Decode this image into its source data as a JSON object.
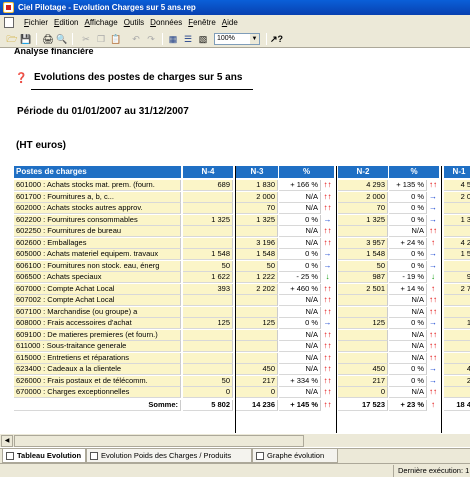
{
  "window": {
    "title": "Ciel Pilotage - Evolution Charges sur 5 ans.rep"
  },
  "menu": [
    "Fichier",
    "Edition",
    "Affichage",
    "Outils",
    "Données",
    "Fenêtre",
    "Aide"
  ],
  "toolbar": {
    "icons": [
      "open-icon",
      "save-icon",
      "print-icon",
      "print-preview-icon",
      "cut-icon",
      "copy-icon",
      "paste-icon",
      "undo-icon",
      "redo-icon",
      "grid-view-icon",
      "list-view-icon",
      "table-view-icon",
      "help-icon"
    ],
    "zoom": "100%"
  },
  "report": {
    "section_title": "Analyse financière",
    "title": "Evolutions des postes de charges sur 5 ans",
    "period": "Période du  01/01/2007   au   31/12/2007",
    "units": "(HT euros)"
  },
  "table": {
    "headers": {
      "label": "Postes de charges",
      "n4": "N-4",
      "n3": "N-3",
      "pct1": "%",
      "n2": "N-2",
      "pct2": "%",
      "n1": "N-1"
    },
    "rows": [
      {
        "label": "601000 : Achats stocks mat. prem. (fourn.",
        "n4": "689",
        "n3": "1 830",
        "pct1": "+ 166 %",
        "ar1": "up2",
        "n2": "4 293",
        "pct2": "+ 135 %",
        "ar2": "up2",
        "n1": "4 5"
      },
      {
        "label": "601700 : Fournitures a, b, c...",
        "n4": "",
        "n3": "2 000",
        "pct1": "N/A",
        "ar1": "up2",
        "n2": "2 000",
        "pct2": "0 %",
        "ar2": "right",
        "n1": "2 0"
      },
      {
        "label": "602000 : Achats stocks autres approv.",
        "n4": "",
        "n3": "70",
        "pct1": "N/A",
        "ar1": "up2",
        "n2": "70",
        "pct2": "0 %",
        "ar2": "right",
        "n1": ""
      },
      {
        "label": "602200 : Fournitures consommables",
        "n4": "1 325",
        "n3": "1 325",
        "pct1": "0 %",
        "ar1": "right",
        "n2": "1 325",
        "pct2": "0 %",
        "ar2": "right",
        "n1": "1 3"
      },
      {
        "label": "602250 : Fournitures de bureau",
        "n4": "",
        "n3": "",
        "pct1": "N/A",
        "ar1": "up2",
        "n2": "",
        "pct2": "N/A",
        "ar2": "up2",
        "n1": ""
      },
      {
        "label": "602600 : Emballages",
        "n4": "",
        "n3": "3 196",
        "pct1": "N/A",
        "ar1": "up2",
        "n2": "3 957",
        "pct2": "+ 24 %",
        "ar2": "up",
        "n1": "4 2"
      },
      {
        "label": "605000 : Achats materiel equipem. travaux",
        "n4": "1 548",
        "n3": "1 548",
        "pct1": "0 %",
        "ar1": "right",
        "n2": "1 548",
        "pct2": "0 %",
        "ar2": "right",
        "n1": "1 5"
      },
      {
        "label": "606100 : Fournitures non stock. eau, énerg",
        "n4": "50",
        "n3": "50",
        "pct1": "0 %",
        "ar1": "right",
        "n2": "50",
        "pct2": "0 %",
        "ar2": "right",
        "n1": ""
      },
      {
        "label": "606500 : Achats speciaux",
        "n4": "1 622",
        "n3": "1 222",
        "pct1": "- 25 %",
        "ar1": "down",
        "n2": "987",
        "pct2": "- 19 %",
        "ar2": "down",
        "n1": "9"
      },
      {
        "label": "607000 : Compte Achat Local",
        "n4": "393",
        "n3": "2 202",
        "pct1": "+ 460 %",
        "ar1": "up2",
        "n2": "2 501",
        "pct2": "+ 14 %",
        "ar2": "up",
        "n1": "2 7"
      },
      {
        "label": "607002 : Compte Achat Local",
        "n4": "",
        "n3": "",
        "pct1": "N/A",
        "ar1": "up2",
        "n2": "",
        "pct2": "N/A",
        "ar2": "up2",
        "n1": ""
      },
      {
        "label": "607100 : Marchandise (ou groupe) a",
        "n4": "",
        "n3": "",
        "pct1": "N/A",
        "ar1": "up2",
        "n2": "",
        "pct2": "N/A",
        "ar2": "up2",
        "n1": ""
      },
      {
        "label": "608000 : Frais accessoires d'achat",
        "n4": "125",
        "n3": "125",
        "pct1": "0 %",
        "ar1": "right",
        "n2": "125",
        "pct2": "0 %",
        "ar2": "right",
        "n1": "1"
      },
      {
        "label": "609100 : De matieres premieres (et fourn.)",
        "n4": "",
        "n3": "",
        "pct1": "N/A",
        "ar1": "up2",
        "n2": "",
        "pct2": "N/A",
        "ar2": "up2",
        "n1": ""
      },
      {
        "label": "611000 : Sous-traitance generale",
        "n4": "",
        "n3": "",
        "pct1": "N/A",
        "ar1": "up2",
        "n2": "",
        "pct2": "N/A",
        "ar2": "up2",
        "n1": ""
      },
      {
        "label": "615000 : Entretiens et réparations",
        "n4": "",
        "n3": "",
        "pct1": "N/A",
        "ar1": "up2",
        "n2": "",
        "pct2": "N/A",
        "ar2": "up2",
        "n1": ""
      },
      {
        "label": "623400 : Cadeaux a la clientele",
        "n4": "",
        "n3": "450",
        "pct1": "N/A",
        "ar1": "up2",
        "n2": "450",
        "pct2": "0 %",
        "ar2": "right",
        "n1": "4"
      },
      {
        "label": "626000 : Frais postaux et de télécomm.",
        "n4": "50",
        "n3": "217",
        "pct1": "+ 334 %",
        "ar1": "up2",
        "n2": "217",
        "pct2": "0 %",
        "ar2": "right",
        "n1": "2"
      },
      {
        "label": "670000 : Charges exceptionnelles",
        "n4": "0",
        "n3": "0",
        "pct1": "N/A",
        "ar1": "up2",
        "n2": "0",
        "pct2": "N/A",
        "ar2": "up2",
        "n1": ""
      }
    ],
    "sum": {
      "label": "Somme:",
      "n4": "5 802",
      "n3": "14 236",
      "pct1": "+ 145 %",
      "ar1": "up2",
      "n2": "17 523",
      "pct2": "+ 23 %",
      "ar2": "up",
      "n1": "18 4"
    }
  },
  "tabs": [
    "Tableau Evolution",
    "Evolution Poids des Charges / Produits",
    "Graphe évolution"
  ],
  "status": {
    "text": "Dernière exécution: 1"
  }
}
